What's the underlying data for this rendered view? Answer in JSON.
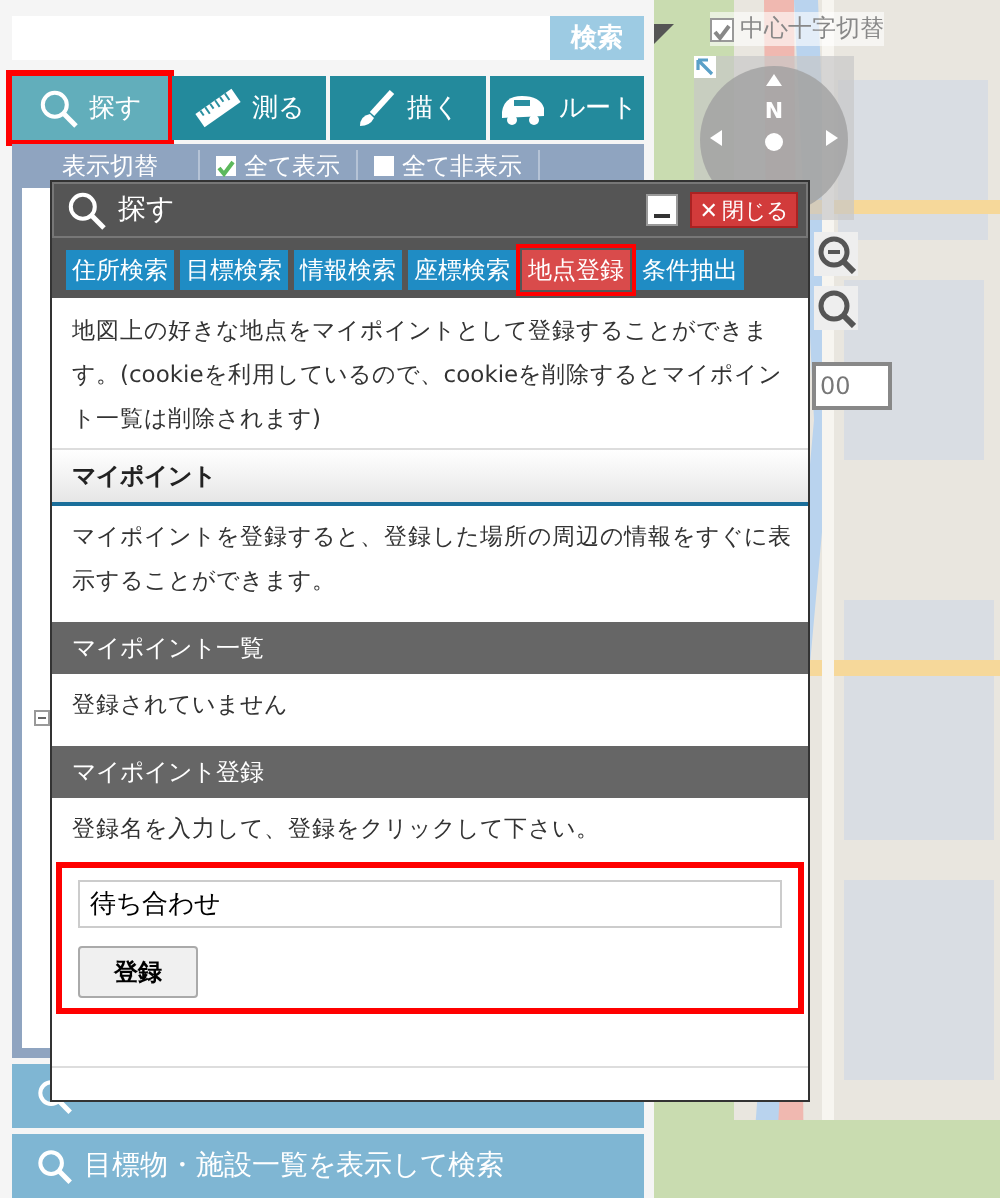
{
  "search": {
    "button": "検索"
  },
  "tabs": [
    {
      "label": "探す",
      "kind": "search",
      "selected": true,
      "highlighted": true
    },
    {
      "label": "測る",
      "kind": "measure",
      "selected": false,
      "highlighted": false
    },
    {
      "label": "描く",
      "kind": "draw",
      "selected": false,
      "highlighted": false
    },
    {
      "label": "ルート",
      "kind": "route",
      "selected": false,
      "highlighted": false
    }
  ],
  "toolbar": {
    "label": "表示切替",
    "options": [
      {
        "label": "全て表示",
        "checked": true
      },
      {
        "label": "全て非表示",
        "checked": false
      }
    ]
  },
  "bottom_buttons": [
    {
      "kind": "covered"
    },
    {
      "kind": "labeled",
      "label": "目標物・施設一覧を表示して検索"
    }
  ],
  "map": {
    "crosshair_toggle": {
      "label": "中心十字切替",
      "checked": true
    },
    "compass_label": "N",
    "scale_value": "00"
  },
  "dialog": {
    "title": "探す",
    "close_glyph": "✕",
    "close_label": "閉じる",
    "tabs": [
      {
        "label": "住所検索",
        "selected": false,
        "highlighted": false
      },
      {
        "label": "目標検索",
        "selected": false,
        "highlighted": false
      },
      {
        "label": "情報検索",
        "selected": false,
        "highlighted": false
      },
      {
        "label": "座標検索",
        "selected": false,
        "highlighted": false
      },
      {
        "label": "地点登録",
        "selected": true,
        "highlighted": true
      },
      {
        "label": "条件抽出",
        "selected": false,
        "highlighted": false
      }
    ],
    "intro": "地図上の好きな地点をマイポイントとして登録することができます。(cookieを利用しているので、cookieを削除するとマイポイント一覧は削除されます)",
    "sections": [
      {
        "title": "マイポイント",
        "kind": "subheading",
        "text": "マイポイントを登録すると、登録した場所の周辺の情報をすぐに表示することができます。"
      },
      {
        "title": "マイポイント一覧",
        "kind": "heading",
        "text": "登録されていません"
      },
      {
        "title": "マイポイント登録",
        "kind": "heading",
        "text": "登録名を入力して、登録をクリックして下さい。",
        "form": {
          "value": "待ち合わせ",
          "button": "登録",
          "highlighted": true
        }
      }
    ]
  }
}
